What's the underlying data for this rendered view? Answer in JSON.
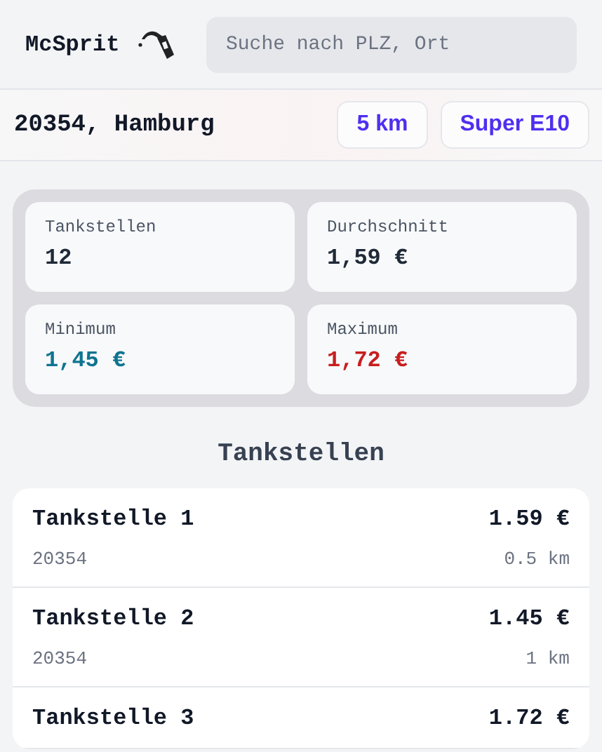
{
  "header": {
    "app_name": "McSprit",
    "search": {
      "placeholder": "Suche nach PLZ, Ort"
    }
  },
  "location": {
    "text": "20354, Hamburg",
    "buttons": [
      "5 km",
      "Super E10"
    ]
  },
  "stats": [
    {
      "label": "Tankstellen",
      "value": "12",
      "color": "#1f2937"
    },
    {
      "label": "Durchschnitt",
      "value": "1,59 €",
      "color": "#1f2937"
    },
    {
      "label": "Minimum",
      "value": "1,45 €",
      "color": "#0e7490"
    },
    {
      "label": "Maximum",
      "value": "1,72 €",
      "color": "#c81e1e"
    }
  ],
  "list_title": "Tankstellen",
  "stations": [
    {
      "name": "Tankstelle 1",
      "price": "1.59 €",
      "postcode": "20354",
      "distance": "0.5 km"
    },
    {
      "name": "Tankstelle 2",
      "price": "1.45 €",
      "postcode": "20354",
      "distance": "1 km"
    },
    {
      "name": "Tankstelle 3",
      "price": "1.72 €"
    }
  ]
}
